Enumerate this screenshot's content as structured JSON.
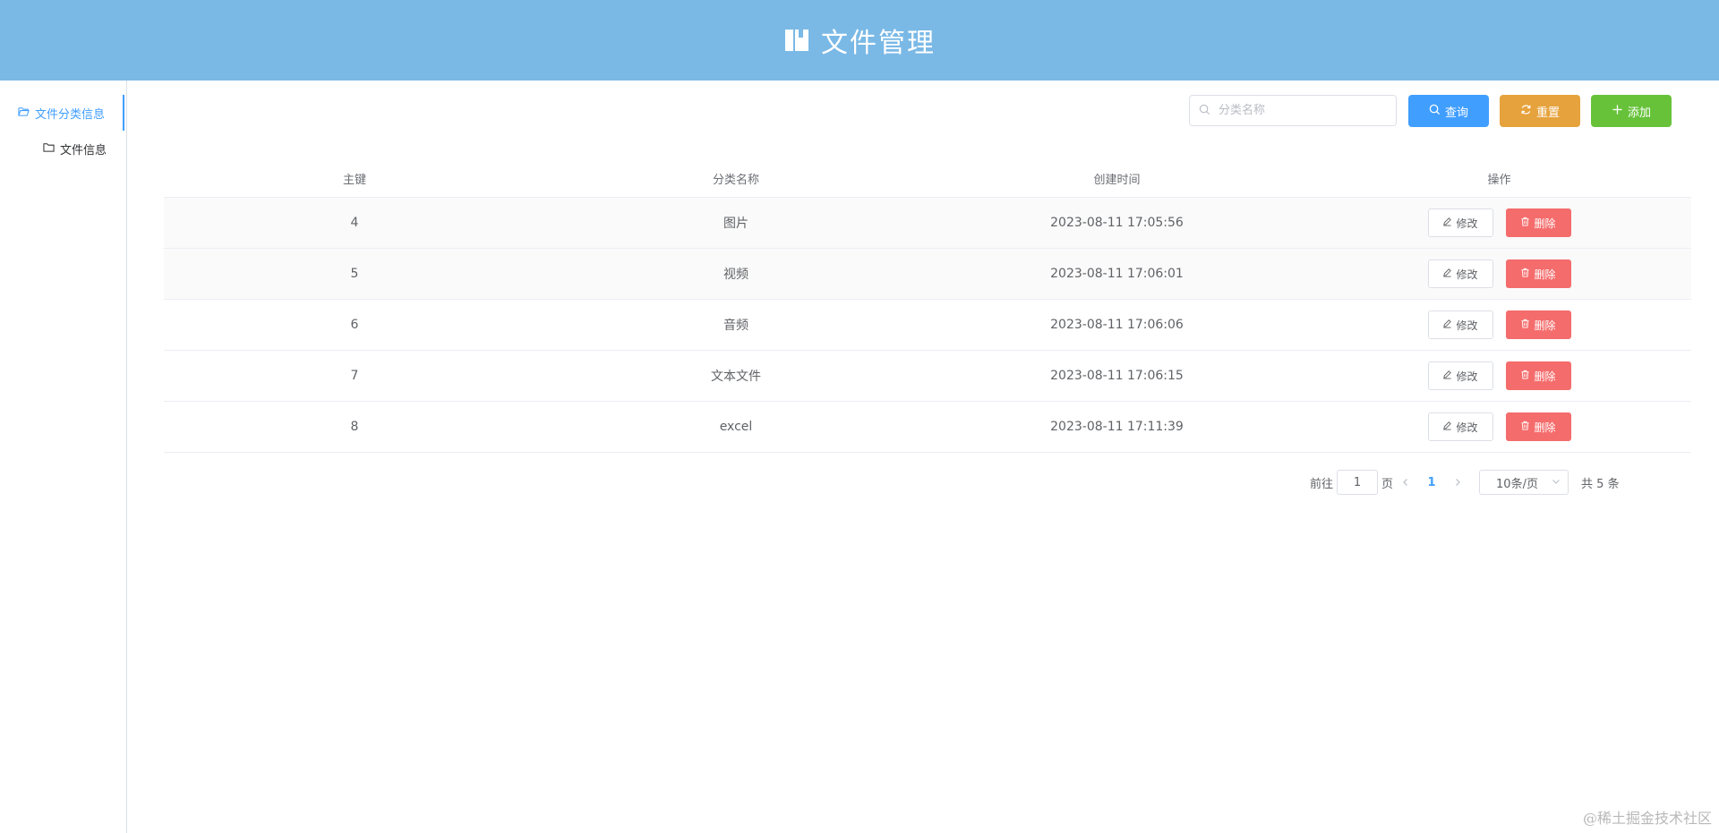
{
  "header": {
    "title": "文件管理",
    "bg_color": "#7ab9e6",
    "icon": "book-icon"
  },
  "sidebar": {
    "items": [
      {
        "label": "文件分类信息",
        "icon": "folder-open-icon",
        "active": true
      },
      {
        "label": "文件信息",
        "icon": "folder-icon",
        "active": false
      }
    ]
  },
  "toolbar": {
    "search_placeholder": "分类名称",
    "search_value": "",
    "query_label": "查询",
    "reset_label": "重置",
    "add_label": "添加",
    "colors": {
      "query": "#409eff",
      "reset": "#e6a23c",
      "add": "#67c23a"
    }
  },
  "table": {
    "headers": [
      "主键",
      "分类名称",
      "创建时间",
      "操作"
    ],
    "rows": [
      {
        "id": "4",
        "name": "图片",
        "created": "2023-08-11 17:05:56"
      },
      {
        "id": "5",
        "name": "视频",
        "created": "2023-08-11 17:06:01"
      },
      {
        "id": "6",
        "name": "音频",
        "created": "2023-08-11 17:06:06"
      },
      {
        "id": "7",
        "name": "文本文件",
        "created": "2023-08-11 17:06:15"
      },
      {
        "id": "8",
        "name": "excel",
        "created": "2023-08-11 17:11:39"
      }
    ],
    "edit_label": "修改",
    "delete_label": "删除",
    "delete_color": "#f56c6c"
  },
  "pagination": {
    "goto_prefix": "前往",
    "goto_value": "1",
    "goto_suffix": "页",
    "current_page": "1",
    "page_size": "10条/页",
    "total": "共 5 条"
  },
  "watermark": "@稀土掘金技术社区"
}
